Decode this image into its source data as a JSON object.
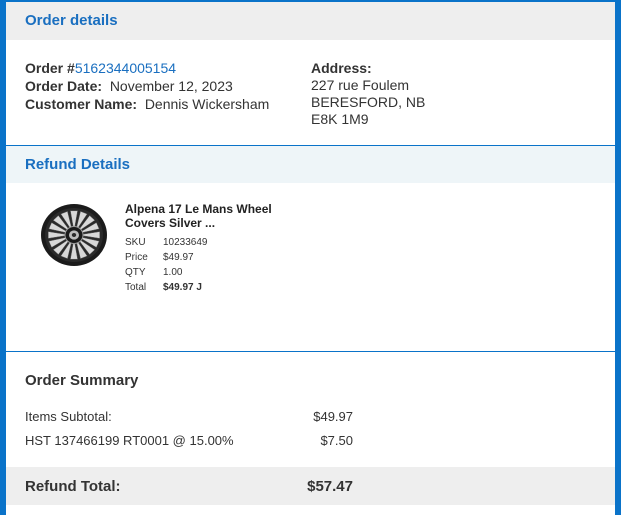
{
  "order_details": {
    "title": "Order details",
    "order_label": "Order #",
    "order_number": "5162344005154",
    "date_label": "Order Date:",
    "date_value": "November 12, 2023",
    "customer_label": "Customer Name:",
    "customer_value": "Dennis Wickersham",
    "address_label": "Address:",
    "address_lines": [
      "227 rue Foulem",
      "BERESFORD, NB",
      "E8K 1M9"
    ]
  },
  "refund_details": {
    "title": "Refund Details",
    "product": {
      "name": "Alpena 17 Le Mans Wheel Covers Silver ...",
      "image_icon": "wheel-cover-image",
      "sku_label": "SKU",
      "sku_value": "10233649",
      "price_label": "Price",
      "price_value": "$49.97",
      "qty_label": "QTY",
      "qty_value": "1.00",
      "total_label": "Total",
      "total_value": "$49.97 J"
    }
  },
  "order_summary": {
    "title": "Order Summary",
    "rows": [
      {
        "label": "Items Subtotal:",
        "value": "$49.97"
      },
      {
        "label": "HST 137466199 RT0001 @ 15.00%",
        "value": "$7.50"
      }
    ],
    "refund_total_label": "Refund Total:",
    "refund_total_value": "$57.47"
  },
  "colors": {
    "accent": "#0a73c9",
    "link": "#1a6fc0",
    "header_bg": "#eeeeee",
    "refund_header_bg": "#eef5f8"
  }
}
